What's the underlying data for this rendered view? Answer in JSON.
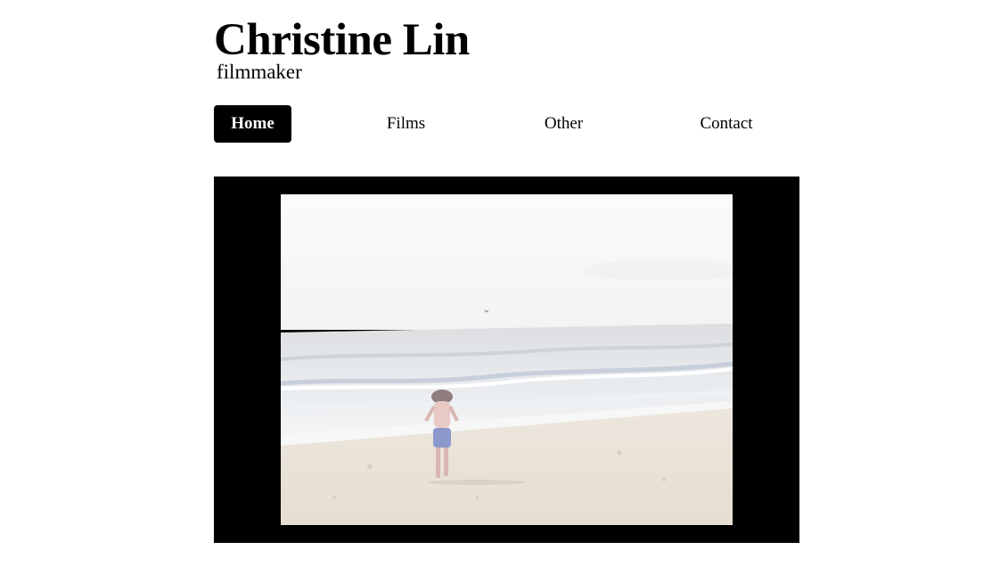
{
  "header": {
    "title": "Christine Lin",
    "subtitle": "filmmaker"
  },
  "nav": {
    "items": [
      {
        "label": "Home",
        "active": true
      },
      {
        "label": "Films",
        "active": false
      },
      {
        "label": "Other",
        "active": false
      },
      {
        "label": "Contact",
        "active": false
      }
    ]
  },
  "colors": {
    "nav_active_bg": "#000000",
    "nav_active_text": "#ffffff",
    "video_frame_bg": "#000000"
  }
}
